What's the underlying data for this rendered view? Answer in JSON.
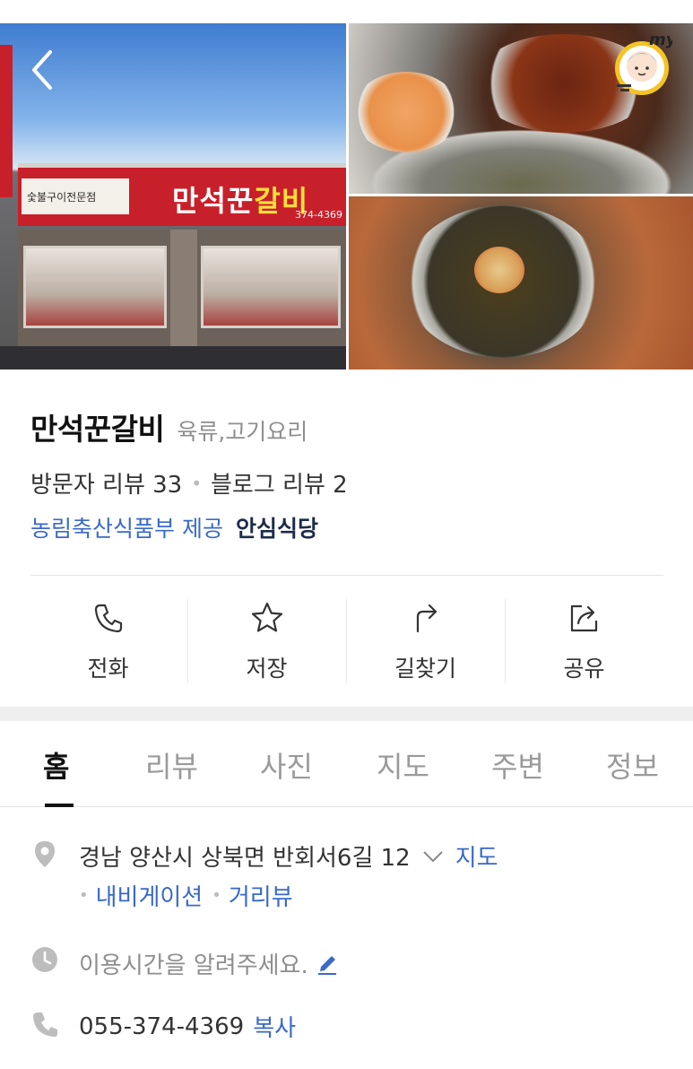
{
  "gallery": {
    "sign_small": "숯불구이전문점",
    "sign_main_a": "만석꾼",
    "sign_main_b": "갈비",
    "sign_phone": "374-4369",
    "badge_text": "my"
  },
  "place": {
    "name": "만석꾼갈비",
    "category": "육류,고기요리",
    "visitor_reviews": "방문자 리뷰 33",
    "blog_reviews": "블로그 리뷰 2",
    "provider": "농림축산식품부 제공",
    "safe_badge": "안심식당"
  },
  "actions": [
    {
      "label": "전화",
      "icon": "phone-icon"
    },
    {
      "label": "저장",
      "icon": "star-icon"
    },
    {
      "label": "길찾기",
      "icon": "directions-icon"
    },
    {
      "label": "공유",
      "icon": "share-icon"
    }
  ],
  "tabs": [
    {
      "label": "홈",
      "active": true
    },
    {
      "label": "리뷰"
    },
    {
      "label": "사진"
    },
    {
      "label": "지도"
    },
    {
      "label": "주변"
    },
    {
      "label": "정보"
    }
  ],
  "detail": {
    "address": "경남 양산시 상북면 반회서6길 12",
    "map_link": "지도",
    "navigation_link": "내비게이션",
    "street_view_link": "거리뷰",
    "hours_prompt": "이용시간을 알려주세요.",
    "phone": "055-374-4369",
    "copy_label": "복사"
  },
  "colors": {
    "link": "#3a69c8",
    "sign_red": "#c8202a",
    "accent_yellow": "#f5c324"
  }
}
